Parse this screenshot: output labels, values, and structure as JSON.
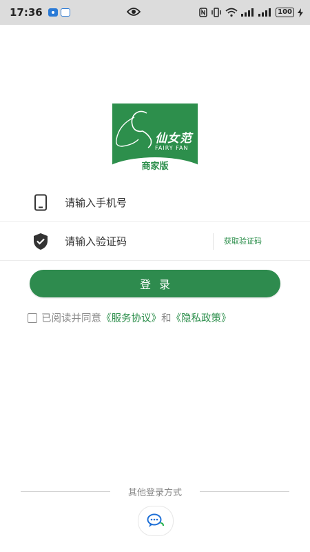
{
  "status_bar": {
    "time": "17:36",
    "battery": "100"
  },
  "logo": {
    "brand_cn": "仙女范",
    "brand_en": "FAIRY FAN",
    "edition": "商家版"
  },
  "form": {
    "phone_placeholder": "请输入手机号",
    "code_placeholder": "请输入验证码",
    "get_code_label": "获取验证码"
  },
  "login_label": "登录",
  "agreement": {
    "prefix": "已阅读并同意",
    "service_link": "《服务协议》",
    "and": "和",
    "privacy_link": "《隐私政策》"
  },
  "other_login": {
    "label": "其他登录方式"
  },
  "colors": {
    "brand_green": "#2d8f4c",
    "status_bar_bg": "#dcdcdc"
  },
  "icons": {
    "phone_field": "smartphone-icon",
    "code_field": "shield-check-icon",
    "other_login": "chat-bubble-icon"
  }
}
